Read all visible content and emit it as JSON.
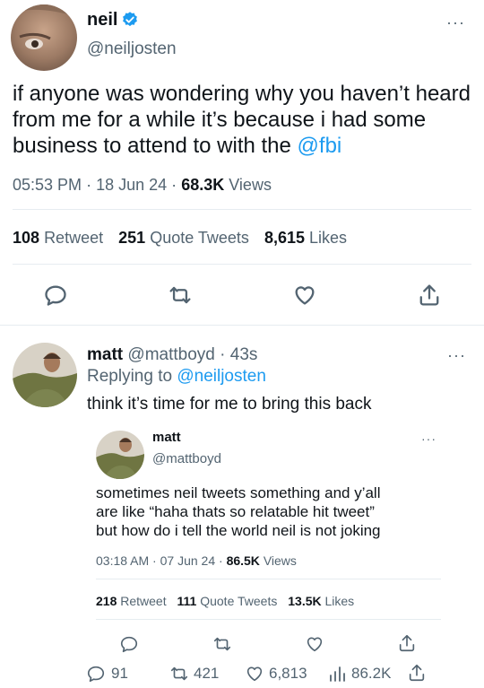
{
  "main_tweet": {
    "display_name": "neil",
    "handle": "@neiljosten",
    "text_plain": "if anyone was wondering why you haven’t heard from me for a while it’s because i had some business to attend to with the",
    "mention": "@fbi",
    "time": "05:53 PM",
    "sep1": "·",
    "date": "18 Jun 24",
    "sep2": "·",
    "views_count": "68.3K",
    "views_label": "Views",
    "stats": {
      "retweets_count": "108",
      "retweets_label": "Retweet",
      "quotes_count": "251",
      "quotes_label": "Quote Tweets",
      "likes_count": "8,615",
      "likes_label": "Likes"
    },
    "actions": [
      "reply-icon",
      "retweet-icon",
      "like-icon",
      "share-icon"
    ]
  },
  "reply": {
    "display_name": "matt",
    "handle": "@mattboyd",
    "sep": "·",
    "age": "43s",
    "replying_label": "Replying to",
    "replying_to": "@neiljosten",
    "text": "think it’s time for me to bring this back",
    "footer": {
      "reply_count": "91",
      "retweet_count": "421",
      "like_count": "6,813",
      "views_count": "86.2K"
    }
  },
  "quoted_tweet": {
    "display_name": "matt",
    "handle": "@mattboyd",
    "text_line1": "sometimes neil tweets something and y’all",
    "text_line2": "are like “haha thats so relatable hit tweet”",
    "text_line3": "but how do i tell the world neil is not joking",
    "time": "03:18 AM",
    "sep1": "·",
    "date": "07 Jun 24",
    "sep2": "·",
    "views_count": "86.5K",
    "views_label": "Views",
    "stats": {
      "retweets_count": "218",
      "retweets_label": "Retweet",
      "quotes_count": "111",
      "quotes_label": "Quote Tweets",
      "likes_count": "13.5K",
      "likes_label": "Likes"
    }
  },
  "colors": {
    "accent": "#1d9bf0",
    "muted": "#536471",
    "text": "#0f1419"
  }
}
